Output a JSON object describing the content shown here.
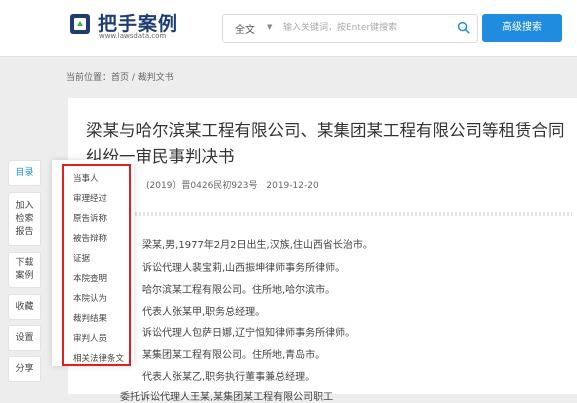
{
  "header": {
    "logo_text": "把手案例",
    "logo_url": "www.lawsdata.com",
    "search_scope": "全文",
    "search_placeholder": "输入关键词，按Enter键搜索",
    "advanced_search_label": "高级搜索"
  },
  "breadcrumb": "当前位置：首页 / 裁判文书",
  "document": {
    "title": "梁某与哈尔滨某工程有限公司、某集团某工程有限公司等租赁合同纠纷一审民事判决书",
    "case_number": "(2019）晋0426民初923号",
    "date": "2019-12-20",
    "paragraphs": [
      "梁某,男,1977年2月2日出生,汉族,住山西省长治市。",
      "诉讼代理人裴宝莉,山西振坤律师事务所律师。",
      "哈尔滨某工程有限公司。住所地,哈尔滨市。",
      "代表人张某甲,职务总经理。",
      "诉讼代理人包萨日娜,辽宁恒知律师事务所律师。",
      "某集团某工程有限公司。住所地,青岛市。",
      "代表人张某乙,职务执行董事兼总经理。",
      "委托诉讼代理人王某,某集团某工程有限公司职工"
    ]
  },
  "sidebar": {
    "items": [
      {
        "label": "目录"
      },
      {
        "label": "加入检索报告"
      },
      {
        "label": "下载案例"
      },
      {
        "label": "收藏"
      },
      {
        "label": "设置"
      },
      {
        "label": "分享"
      }
    ]
  },
  "toc": {
    "items": [
      "当事人",
      "审理经过",
      "原告诉称",
      "被告辩称",
      "证据",
      "本院查明",
      "本院认为",
      "裁判结果",
      "审判人员",
      "相关法律条文"
    ]
  },
  "colors": {
    "accent": "#1f8ce0",
    "highlight_border": "#e02020",
    "logo": "#1f3d73"
  }
}
